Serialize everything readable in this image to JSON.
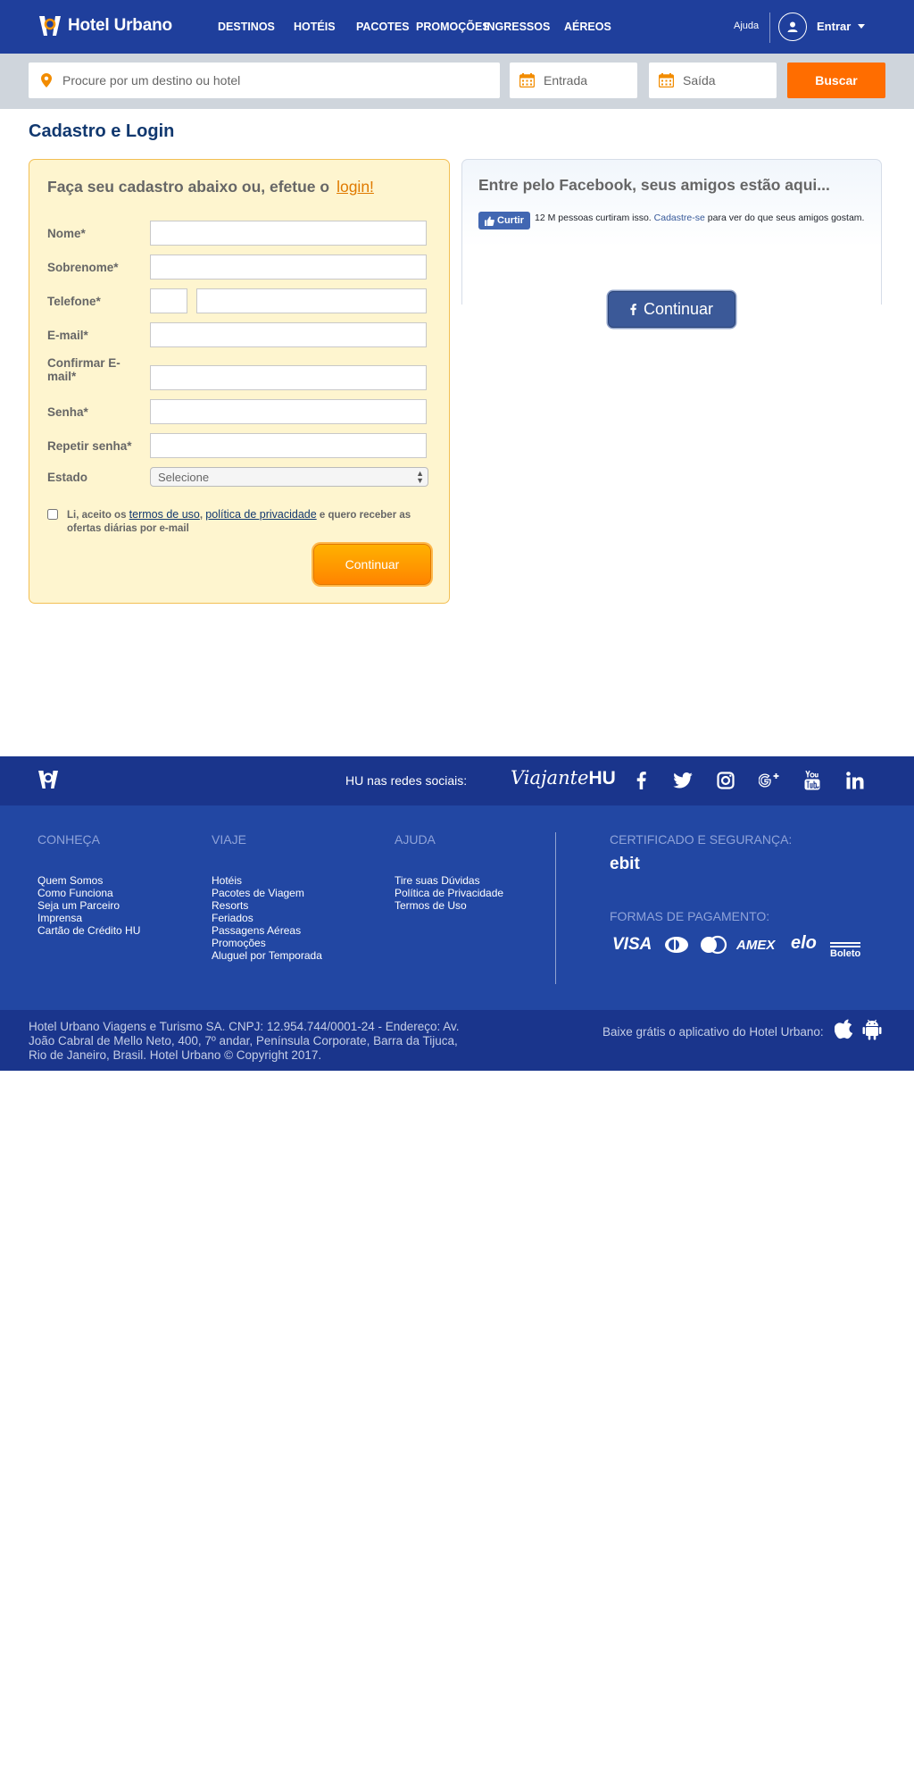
{
  "header": {
    "logo_text": "Hotel Urbano",
    "nav": [
      "DESTINOS",
      "HOTÉIS",
      "PACOTES",
      "PROMOÇÕES",
      "INGRESSOS",
      "AÉREOS"
    ],
    "help": "Ajuda",
    "login": "Entrar"
  },
  "search": {
    "destination_placeholder": "Procure por um destino ou hotel",
    "checkin_placeholder": "Entrada",
    "checkout_placeholder": "Saída",
    "button": "Buscar"
  },
  "page_title": "Cadastro e Login",
  "signup": {
    "heading": "Faça seu cadastro abaixo ou, efetue o",
    "login_link": "login!",
    "fields": {
      "nome": "Nome*",
      "sobrenome": "Sobrenome*",
      "telefone": "Telefone*",
      "email": "E-mail*",
      "confirm_email": "Confirmar E-mail*",
      "senha": "Senha*",
      "repetir_senha": "Repetir senha*",
      "estado": "Estado"
    },
    "estado_selected": "Selecione",
    "terms_prefix": "Li, aceito os",
    "terms_link": "termos de uso",
    "terms_comma": ",",
    "privacy_link": "política de privacidade",
    "terms_suffix": "e quero receber as ofertas diárias por e-mail",
    "continue": "Continuar"
  },
  "facebook": {
    "heading": "Entre pelo Facebook, seus amigos estão aqui...",
    "like_button": "Curtir",
    "like_count": "12 M pessoas curtiram isso.",
    "signup_link": "Cadastre-se",
    "like_suffix": "para ver do que seus amigos gostam.",
    "continue": "Continuar"
  },
  "footer": {
    "social_label": "HU nas redes sociais:",
    "viajante_script": "Viajante",
    "viajante_bold": "HU",
    "columns": [
      {
        "title": "CONHEÇA",
        "links": [
          "Quem Somos",
          "Como Funciona",
          "Seja um Parceiro",
          "Imprensa",
          "Cartão de Crédito HU"
        ]
      },
      {
        "title": "VIAJE",
        "links": [
          "Hotéis",
          "Pacotes de Viagem",
          "Resorts",
          "Feriados",
          "Passagens Aéreas",
          "Promoções",
          "Aluguel por Temporada"
        ]
      },
      {
        "title": "AJUDA",
        "links": [
          "Tire suas Dúvidas",
          "Política de Privacidade",
          "Termos de Uso"
        ]
      }
    ],
    "cert_title": "CERTIFICADO E SEGURANÇA:",
    "ebit": "ebit",
    "payment_title": "FORMAS DE PAGAMENTO:",
    "payments": [
      "VISA",
      "AMEX",
      "elo",
      "Boleto"
    ],
    "legal": "Hotel Urbano Viagens e Turismo SA. CNPJ: 12.954.744/0001-24 - Endereço: Av. João Cabral de Mello Neto, 400, 7º andar, Península Corporate, Barra da Tijuca, Rio de Janeiro, Brasil. Hotel Urbano © Copyright 2017.",
    "app_text": "Baixe grátis o aplicativo do Hotel Urbano:"
  },
  "colors": {
    "header_blue": "#1f3f9c",
    "accent_orange": "#ff6d00",
    "title_navy": "#11386f",
    "form_bg": "#fef5cf",
    "facebook_blue": "#3b5998"
  },
  "icons": [
    "location-pin-icon",
    "calendar-icon",
    "user-icon",
    "facebook-icon",
    "twitter-icon",
    "instagram-icon",
    "google-plus-icon",
    "youtube-icon",
    "linkedin-icon",
    "apple-icon",
    "android-icon",
    "thumbs-up-icon"
  ]
}
